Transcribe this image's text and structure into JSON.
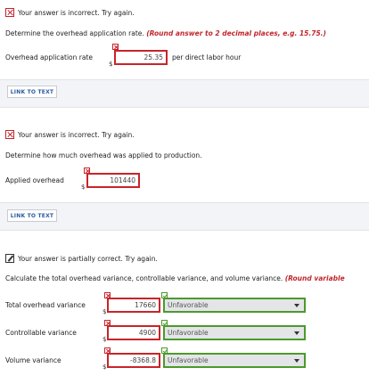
{
  "section1": {
    "status": "Your answer is incorrect.  Try again.",
    "question": "Determine the overhead application rate.",
    "hint": "(Round answer to 2 decimal places, e.g. 15.75.)",
    "field_label": "Overhead application rate",
    "currency": "$",
    "value": "25.35",
    "unit": "per direct labor hour",
    "link": "LINK TO TEXT"
  },
  "section2": {
    "status": "Your answer is incorrect.  Try again.",
    "question": "Determine how much overhead was applied to production.",
    "field_label": "Applied overhead",
    "currency": "$",
    "value": "101440",
    "link": "LINK TO TEXT"
  },
  "section3": {
    "status": "Your answer is partially correct.  Try again.",
    "question": "Calculate the total overhead variance, controllable variance, and volume variance.",
    "hint": "(Round variable",
    "rows": [
      {
        "label": "Total overhead variance",
        "currency": "$",
        "value": "17660",
        "select": "Unfavorable",
        "value_correct": false,
        "select_correct": true
      },
      {
        "label": "Controllable variance",
        "currency": "$",
        "value": "4900",
        "select": "Unfavorable",
        "value_correct": false,
        "select_correct": true
      },
      {
        "label": "Volume variance",
        "currency": "$",
        "value": "-8368.8",
        "select": "Unfavorable",
        "value_correct": false,
        "select_correct": true
      }
    ]
  },
  "icons": {
    "incorrect": "x-mark-icon",
    "partial": "pencil-icon",
    "field_wrong": "x-mark-icon",
    "field_right": "check-icon",
    "dropdown": "chevron-down-icon"
  },
  "colors": {
    "incorrect": "#c8242a",
    "correct": "#4c9a2a",
    "link": "#2b5aa0",
    "band": "#f2f4f7"
  }
}
